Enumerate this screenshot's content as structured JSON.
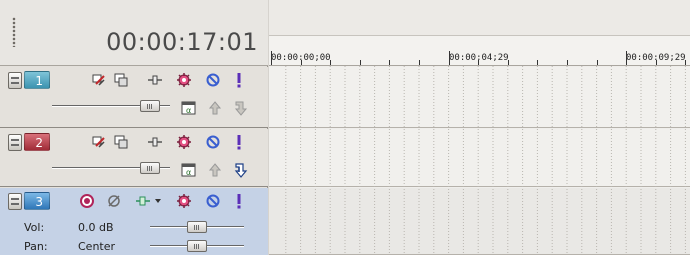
{
  "time_display": "00:00:17:01",
  "ruler": {
    "labels": [
      "00:00:00;00",
      "00:00:04;29",
      "00:00:09;29"
    ]
  },
  "tracks": [
    {
      "number": "1",
      "type": "video",
      "color": "#4aa0bb",
      "icons": [
        "expand-track-keyframes-icon",
        "compositing-mode-icon",
        "track-motion-icon",
        "track-fx-icon",
        "mute-icon",
        "solo-icon",
        "composite-child-icon",
        "make-compositing-parent-icon",
        "make-compositing-child-icon"
      ],
      "level": 0.83
    },
    {
      "number": "2",
      "type": "video",
      "color": "#b03a44",
      "icons": [
        "expand-track-keyframes-icon",
        "compositing-mode-icon",
        "track-motion-icon",
        "track-fx-icon",
        "mute-icon",
        "solo-icon",
        "composite-child-icon",
        "make-compositing-parent-icon",
        "make-compositing-child-icon"
      ],
      "level": 0.83
    },
    {
      "number": "3",
      "type": "audio",
      "color": "#3f8fcb",
      "vol_label": "Vol:",
      "vol_value": "0.0 dB",
      "pan_label": "Pan:",
      "pan_value": "Center",
      "vol_level": 0.5,
      "pan_level": 0.5
    }
  ]
}
